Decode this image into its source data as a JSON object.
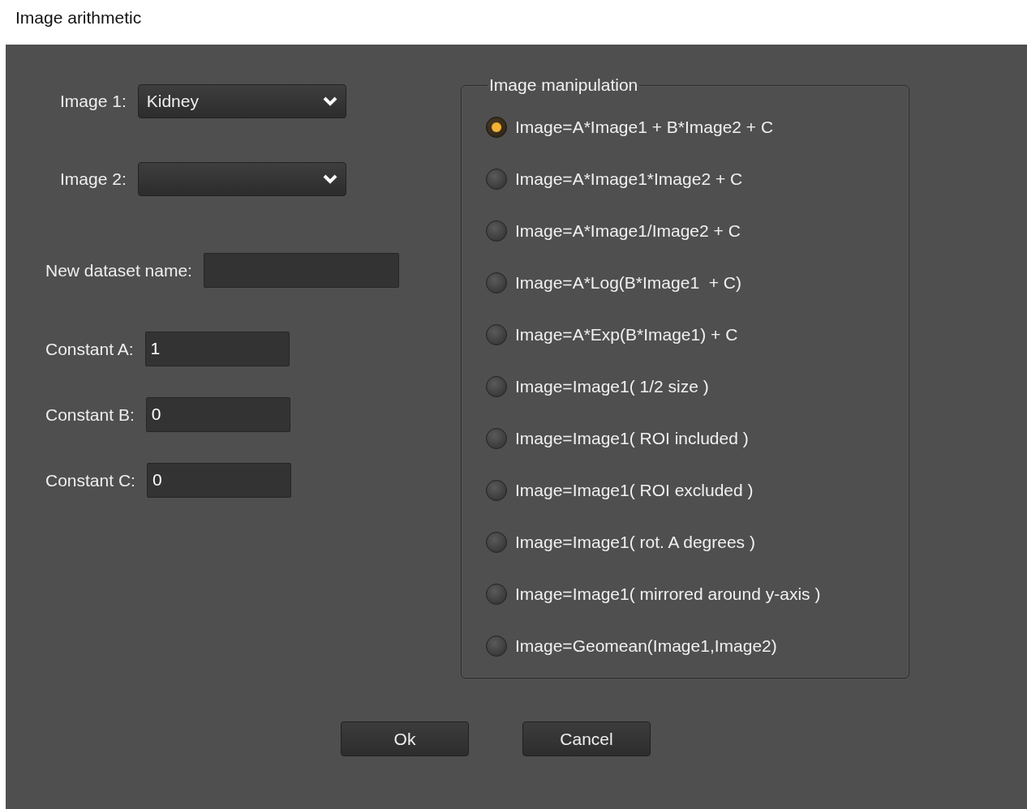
{
  "window": {
    "title": "Image arithmetic"
  },
  "form": {
    "image_1": {
      "label": "Image 1:",
      "value": "Kidney"
    },
    "image_2": {
      "label": "Image 2:"
    },
    "new_dataset_name": {
      "label": "New dataset name:"
    },
    "constants": [
      {
        "label": "Constant A:",
        "value": "1"
      },
      {
        "label": "Constant B:",
        "value": "0"
      },
      {
        "label": "Constant C:",
        "value": "0"
      }
    ]
  },
  "image_manipulation": {
    "title": "Image manipulation",
    "options": [
      {
        "label": "Image=A*Image1 + B*Image2 + C",
        "selected": true
      },
      {
        "label": "Image=A*Image1*Image2 + C",
        "selected": false
      },
      {
        "label": "Image=A*Image1/Image2 + C",
        "selected": false
      },
      {
        "label": "Image=A*Log(B*Image1  + C)",
        "selected": false
      },
      {
        "label": "Image=A*Exp(B*Image1) + C",
        "selected": false
      },
      {
        "label": "Image=Image1( 1/2 size )",
        "selected": false
      },
      {
        "label": "Image=Image1( ROI included )",
        "selected": false
      },
      {
        "label": "Image=Image1( ROI excluded )",
        "selected": false
      },
      {
        "label": "Image=Image1( rot. A degrees )",
        "selected": false
      },
      {
        "label": "Image=Image1( mirrored around y-axis )",
        "selected": false
      },
      {
        "label": "Image=Geomean(Image1,Image2)",
        "selected": false
      }
    ]
  },
  "buttons": [
    "Ok",
    "Cancel"
  ]
}
